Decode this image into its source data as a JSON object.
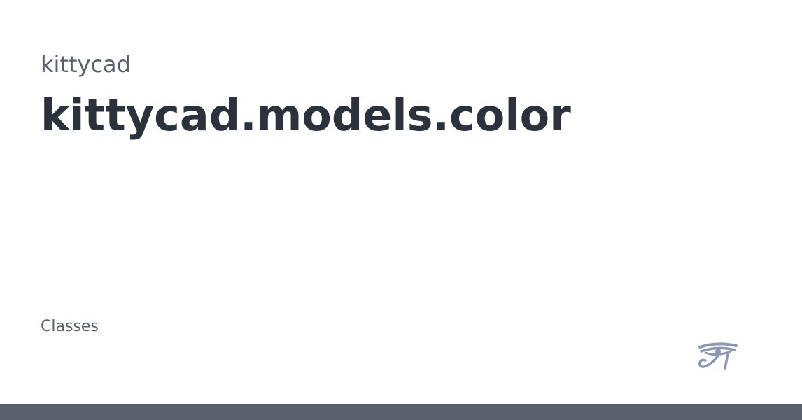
{
  "header": {
    "project_name": "kittycad",
    "page_title": "kittycad.models.color"
  },
  "content": {
    "section_label": "Classes"
  },
  "branding": {
    "logo_icon": "eye-of-horus-icon",
    "logo_color": "#8c97b3"
  },
  "colors": {
    "background": "#ffffff",
    "title_text": "#2b323b",
    "muted_text": "#5a5f68",
    "footer_bar": "#5a606b"
  }
}
